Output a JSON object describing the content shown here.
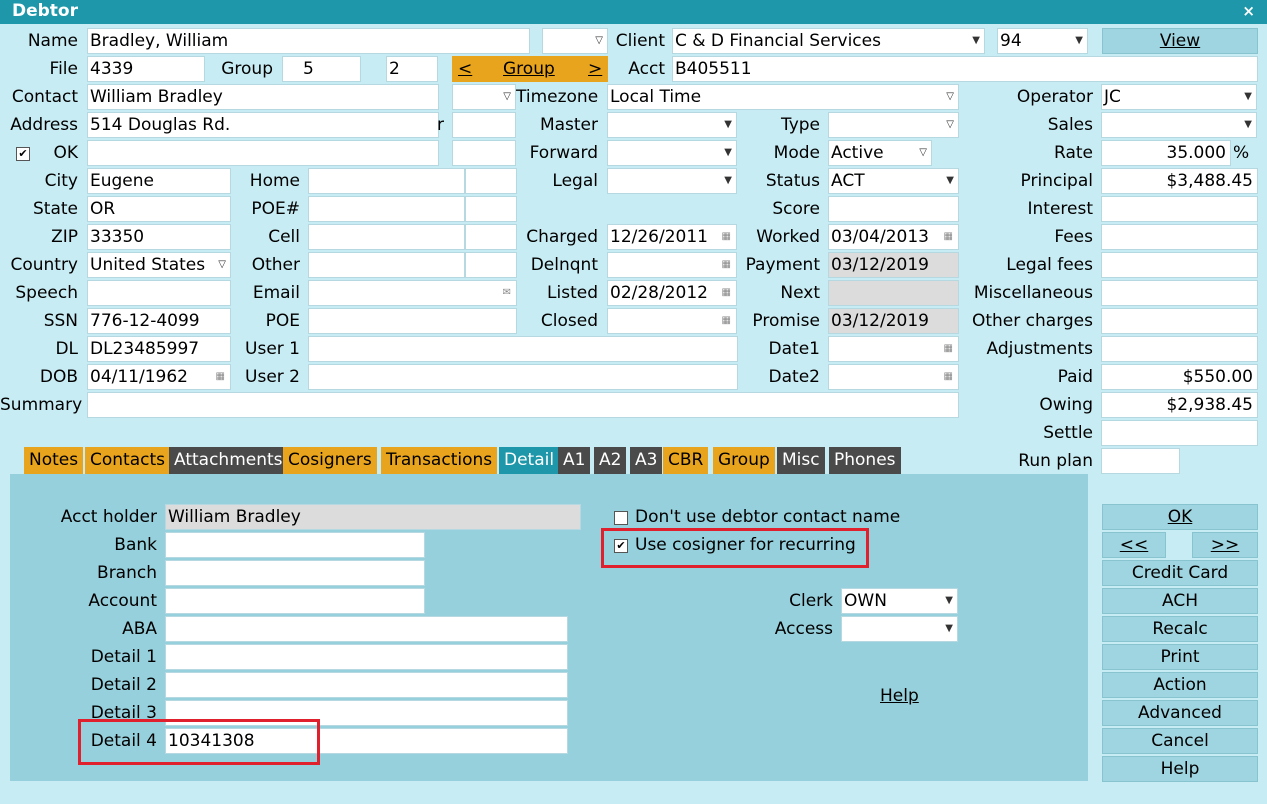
{
  "window": {
    "title": "Debtor",
    "close": "×"
  },
  "top": {
    "name_label": "Name",
    "name": "Bradley, William",
    "client_label": "Client",
    "client": "C & D Financial Services",
    "client_code": "94",
    "view_button": "View",
    "file_label": "File",
    "file": "4339",
    "group_label": "Group",
    "group": "5",
    "group2": "2",
    "group_prev": "<",
    "group_button": "Group",
    "group_next": ">",
    "acct_label": "Acct",
    "acct": "B405511",
    "contact_label": "Contact",
    "contact": "William Bradley",
    "timezone_label": "Timezone",
    "timezone": "Local Time",
    "operator_label": "Operator",
    "operator": "JC",
    "address_label": "Address",
    "address": "514 Douglas Rd.",
    "address_suffix": "r",
    "master_label": "Master",
    "type_label": "Type",
    "sales_label": "Sales",
    "ok_label": "OK",
    "forward_label": "Forward",
    "mode_label": "Mode",
    "mode": "Active",
    "rate_label": "Rate",
    "rate": "35.000",
    "rate_unit": "%"
  },
  "left": {
    "city_label": "City",
    "city": "Eugene",
    "state_label": "State",
    "state": "OR",
    "zip_label": "ZIP",
    "zip": "33350",
    "country_label": "Country",
    "country": "United States",
    "speech_label": "Speech",
    "ssn_label": "SSN",
    "ssn": "776-12-4099",
    "dl_label": "DL",
    "dl": "DL23485997",
    "dob_label": "DOB",
    "dob": "04/11/1962",
    "summary_label": "Summary"
  },
  "mid": {
    "home_label": "Home",
    "poe_hash_label": "POE#",
    "cell_label": "Cell",
    "other_label": "Other",
    "email_label": "Email",
    "poe_label": "POE",
    "user1_label": "User 1",
    "user2_label": "User 2"
  },
  "dates": {
    "legal_label": "Legal",
    "charged_label": "Charged",
    "charged": "12/26/2011",
    "delnqnt_label": "Delnqnt",
    "listed_label": "Listed",
    "listed": "02/28/2012",
    "closed_label": "Closed"
  },
  "status": {
    "status_label": "Status",
    "status": "ACT",
    "score_label": "Score",
    "worked_label": "Worked",
    "worked": "03/04/2013",
    "payment_label": "Payment",
    "payment": "03/12/2019",
    "next_label": "Next",
    "promise_label": "Promise",
    "promise": "03/12/2019",
    "date1_label": "Date1",
    "date2_label": "Date2"
  },
  "financial": {
    "principal_label": "Principal",
    "principal": "$3,488.45",
    "interest_label": "Interest",
    "fees_label": "Fees",
    "legal_fees_label": "Legal fees",
    "misc_label": "Miscellaneous",
    "other_charges_label": "Other charges",
    "adjustments_label": "Adjustments",
    "paid_label": "Paid",
    "paid": "$550.00",
    "owing_label": "Owing",
    "owing": "$2,938.45",
    "settle_label": "Settle",
    "run_plan_label": "Run plan"
  },
  "tabs": [
    "Notes",
    "Contacts",
    "Attachments",
    "Cosigners",
    "Transactions",
    "Detail",
    "A1",
    "A2",
    "A3",
    "CBR",
    "Group",
    "Misc",
    "Phones"
  ],
  "detail": {
    "acct_holder_label": "Acct holder",
    "acct_holder": "William Bradley",
    "bank_label": "Bank",
    "branch_label": "Branch",
    "account_label": "Account",
    "aba_label": "ABA",
    "detail1_label": "Detail 1",
    "detail2_label": "Detail 2",
    "detail3_label": "Detail 3",
    "detail4_label": "Detail 4",
    "detail4": "10341308",
    "dont_use_label": "Don't use debtor contact name",
    "use_cosigner_label": "Use cosigner for recurring",
    "clerk_label": "Clerk",
    "clerk": "OWN",
    "access_label": "Access",
    "help_label": "Help"
  },
  "buttons": {
    "ok": "OK",
    "prev": "<<",
    "next": ">>",
    "credit_card": "Credit Card",
    "ach": "ACH",
    "recalc": "Recalc",
    "print": "Print",
    "action": "Action",
    "advanced": "Advanced",
    "cancel": "Cancel",
    "help": "Help"
  },
  "colors": {
    "titlebar": "#1d97a9",
    "tab_orange": "#e8a41c",
    "tab_dark": "#4a4a4a",
    "tab_active": "#1d97a9",
    "highlight": "#e0202c"
  }
}
